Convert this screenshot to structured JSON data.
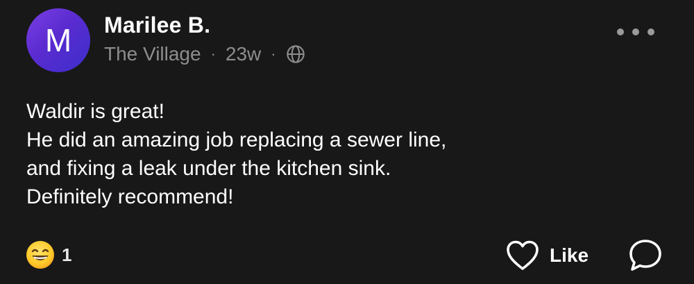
{
  "post": {
    "avatar_letter": "M",
    "author": "Marilee B.",
    "neighborhood": "The Village",
    "separator": "·",
    "age": "23w",
    "visibility_icon": "globe-icon",
    "more_icon": "more-dots-icon",
    "body_lines": [
      "Waldir is great!",
      "He did an amazing job replacing a sewer line,",
      "and fixing a leak under the kitchen sink.",
      "Definitely recommend!"
    ],
    "reaction": {
      "icon": "grinning-emoji-icon",
      "count": "1"
    },
    "actions": {
      "like_label": "Like",
      "like_icon": "heart-icon",
      "comment_icon": "comment-bubble-icon"
    },
    "colors": {
      "background": "#181818",
      "avatar_gradient_start": "#7b3fe4",
      "avatar_gradient_end": "#3b2fc9",
      "secondary_text": "#8d8d8d"
    }
  }
}
